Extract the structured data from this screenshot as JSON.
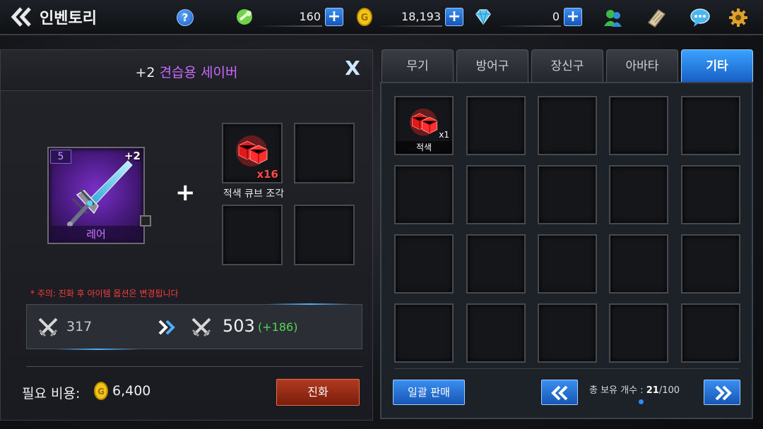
{
  "header": {
    "title": "인벤토리",
    "help_label": "?",
    "resources": [
      {
        "icon": "stamina-icon",
        "value": "160"
      },
      {
        "icon": "gold-coin-icon",
        "value": "18,193"
      },
      {
        "icon": "diamond-icon",
        "value": "0"
      }
    ],
    "plus_label": "+"
  },
  "evolve_panel": {
    "item_plus": "+2",
    "item_name": "견습용 세이버",
    "close_label": "X",
    "weapon": {
      "level": "5",
      "enhance": "+2",
      "rarity": "레어"
    },
    "plus_sign": "+",
    "material": {
      "name": "적색 큐브 조각",
      "count": "x16"
    },
    "warning": "* 주의: 진화 후 아이템 옵션은 변경됩니다",
    "stat_old": "317",
    "stat_new": "503",
    "stat_diff": "(+186)",
    "cost_label": "필요 비용:",
    "cost_value": "6,400",
    "evolve_button": "진화"
  },
  "tabs": [
    "무기",
    "방어구",
    "장신구",
    "아바타",
    "기타"
  ],
  "active_tab": "기타",
  "inventory": {
    "items": [
      {
        "name": "적색",
        "count": "x1"
      }
    ],
    "bulk_sell_label": "일괄 판매",
    "owned_label": "총 보유 개수 :",
    "owned_count": "21",
    "owned_max": "/100"
  },
  "colors": {
    "accent_blue": "#2c8cff",
    "rare_purple": "#c869ff",
    "warning_red": "#ff3b3b",
    "gain_green": "#54d654",
    "evolve_red": "#b23a20"
  }
}
